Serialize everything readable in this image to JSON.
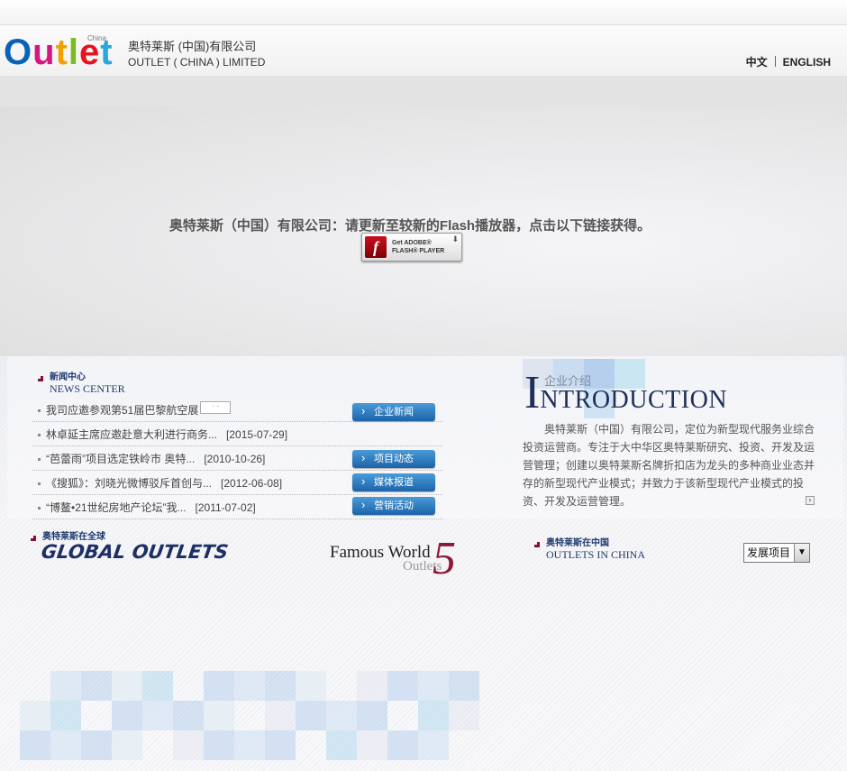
{
  "header": {
    "logo_word": "Outlet",
    "logo_china": "China",
    "company_cn": "奥特莱斯 (中国)有限公司",
    "company_en": "OUTLET ( CHINA ) LIMITED",
    "lang_cn": "中文",
    "lang_en": "ENGLISH"
  },
  "flash": {
    "message": "奥特莱斯（中国）有限公司：请更新至较新的Flash播放器，点击以下链接获得。",
    "button_line1": "Get ADOBE®",
    "button_line2": "FLASH® PLAYER",
    "icon_glyph": "f"
  },
  "news": {
    "title_cn": "新闻中心",
    "title_en": "NEWS CENTER",
    "items": [
      {
        "title": "我司应邀参观第51届巴黎航空展",
        "date": ""
      },
      {
        "title": "林卓延主席应邀赴意大利进行商务...",
        "date": "[2015-07-29]"
      },
      {
        "title": "“芭蕾雨”项目选定铁岭市 奥特...",
        "date": "[2010-10-26]"
      },
      {
        "title": "《搜狐》：刘晓光微博驳斥首创与...",
        "date": "[2012-06-08]"
      },
      {
        "title": "“博鳌•21世纪房地产论坛”我...",
        "date": "[2011-07-02]"
      }
    ],
    "buttons": [
      "企业新闻",
      "项目动态",
      "媒体报道",
      "营销活动"
    ]
  },
  "intro": {
    "title_cn": "企业介绍",
    "title_en_first": "I",
    "title_en_rest": "NTRODUCTION",
    "text": "奥特莱斯（中国）有限公司，定位为新型现代服务业综合投资运营商。专注于大中华区奥特莱斯研究、投资、开发及运营管理；创建以奥特莱斯名牌折扣店为龙头的多种商业业态并存的新型现代产业模式；并致力于该新型现代产业模式的投资、开发及运营管理。"
  },
  "global": {
    "title_cn": "奥特莱斯在全球",
    "title_en": "GLOBAL OUTLETS"
  },
  "famous": {
    "line1": "Famous World",
    "line2": "Outlets",
    "number": "5"
  },
  "china": {
    "title_cn": "奥特莱斯在中国",
    "title_en": "OUTLETS IN CHINA",
    "select_value": "发展项目"
  },
  "colors": {
    "brand_blue": "#1f3a6e",
    "button_blue": "#1c63a9",
    "accent_red": "#8b1030"
  }
}
